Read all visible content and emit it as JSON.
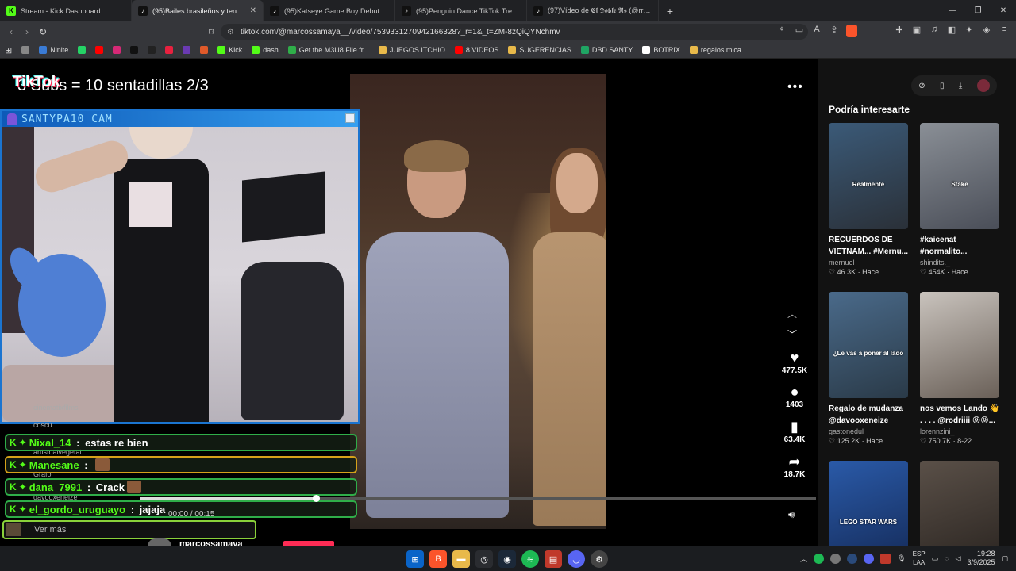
{
  "browser": {
    "tabs": [
      {
        "label": "Stream - Kick Dashboard",
        "icon_color": "#53fc18",
        "icon": "K",
        "active": false
      },
      {
        "label": "(95)Bailes brasileños y tendencia",
        "icon_color": "#111111",
        "icon": "♪",
        "active": true
      },
      {
        "label": "(95)Katseye Game Boy Debut: Level U",
        "icon_color": "#111111",
        "icon": "♪",
        "active": false
      },
      {
        "label": "(95)Penguin Dance TikTok Trend Cor",
        "icon_color": "#111111",
        "icon": "♪",
        "active": false
      },
      {
        "label": "(97)Vídeo de 𝕰𝖑 𝕯𝖔𝖇𝖑𝖊 𝕽𝖘 (@rroman",
        "icon_color": "#111111",
        "icon": "♪",
        "active": false
      }
    ],
    "new_tab": "+",
    "address": "tiktok.com/@marcossamaya__/video/7539331270942166328?_r=1&_t=ZM-8zQiQYNchmv",
    "bookmarks": [
      {
        "label": "",
        "color": "#888888"
      },
      {
        "label": "Ninite",
        "color": "#3a7bd5"
      },
      {
        "label": "",
        "color": "#25d366"
      },
      {
        "label": "",
        "color": "#ff0000"
      },
      {
        "label": "",
        "color": "#d62976"
      },
      {
        "label": "",
        "color": "#111111"
      },
      {
        "label": "",
        "color": "#222222"
      },
      {
        "label": "",
        "color": "#e8213f"
      },
      {
        "label": "",
        "color": "#6a3ab2"
      },
      {
        "label": "",
        "color": "#e05a2a"
      },
      {
        "label": "Kick",
        "color": "#53fc18"
      },
      {
        "label": "dash",
        "color": "#53fc18"
      },
      {
        "label": "Get the M3U8 File fr...",
        "color": "#2fae49"
      },
      {
        "label": "JUEGOS ITCHIO",
        "color": "#e8b94a"
      },
      {
        "label": "8 VIDEOS",
        "color": "#ff0000"
      },
      {
        "label": "SUGERENCIAS",
        "color": "#e8b94a"
      },
      {
        "label": "DBD SANTY",
        "color": "#1fa463"
      },
      {
        "label": "BOTRIX",
        "color": "#ffffff"
      },
      {
        "label": "regalos mica",
        "color": "#e8b94a"
      }
    ]
  },
  "video": {
    "overlay_text": "3 Subs = 10 sentadillas  2/3",
    "logo": "TikTok",
    "cam_title": "SANTYPA10 CAM",
    "time": "00:00 / 00:15",
    "progress": 0.26,
    "author": "marcossamaya",
    "actions": [
      {
        "icon": "♥",
        "count": "477.5K",
        "name": "like"
      },
      {
        "icon": "●",
        "count": "1403",
        "name": "comment"
      },
      {
        "icon": "▮",
        "count": "63.4K",
        "name": "bookmark"
      },
      {
        "icon": "➦",
        "count": "18.7K",
        "name": "share"
      }
    ]
  },
  "chat": {
    "ghost_lines": [
      "cinematixfilms",
      "coscu",
      "artistoalvegetal",
      "Grafo",
      "davooxeneize"
    ],
    "messages": [
      {
        "user": "Nixal_14",
        "sep": " : ",
        "text": "estas re bien",
        "border": "green",
        "emote": false
      },
      {
        "user": "Manesane",
        "sep": " : ",
        "text": "",
        "border": "yellow",
        "emote": true
      },
      {
        "user": "dana_7991",
        "sep": " : ",
        "text": "Crack",
        "border": "green",
        "emote": true
      },
      {
        "user": "el_gordo_uruguayo",
        "sep": " : ",
        "text": "jajaja",
        "border": "green",
        "emote": false
      }
    ],
    "kick_badge": "K",
    "see_more": "Ver más"
  },
  "sidebar": {
    "title": "Podría interesarte",
    "cards": [
      {
        "title": "RECUERDOS DE\nVIETNAM... #Mernu...",
        "author": "mernuel",
        "stats": "♡ 46.3K · Hace...",
        "thumb_label": "Realmente",
        "c1": "#3b5a78",
        "c2": "#2a3038"
      },
      {
        "title": "#kaicenat\n#normalito...",
        "author": "shindits._",
        "stats": "♡ 454K · Hace...",
        "thumb_label": "Stake",
        "c1": "#8a8f96",
        "c2": "#4a4e58"
      },
      {
        "title": "Regalo de mudanza\n@davooxeneize",
        "author": "gastonedul",
        "stats": "♡ 125.2K · Hace...",
        "thumb_label": "¿Le vas a poner al lado",
        "c1": "#4a6a8a",
        "c2": "#2a3a48"
      },
      {
        "title": "nos vemos Lando 👋\n. . . . @rodriiii 😡😡...",
        "author": "lorennzini_",
        "stats": "♡ 750.7K · 8-22",
        "thumb_label": "",
        "c1": "#c9c3bd",
        "c2": "#6a6058"
      },
      {
        "title": "",
        "author": "",
        "stats": "",
        "thumb_label": "LEGO STAR WARS",
        "c1": "#2a5aa8",
        "c2": "#142a58"
      },
      {
        "title": "",
        "author": "",
        "stats": "",
        "thumb_label": "",
        "c1": "#5a5048",
        "c2": "#2a2420"
      }
    ]
  },
  "taskbar": {
    "lang": "ESP",
    "lang2": "LAA",
    "time": "19:28",
    "date": "3/9/2025"
  }
}
